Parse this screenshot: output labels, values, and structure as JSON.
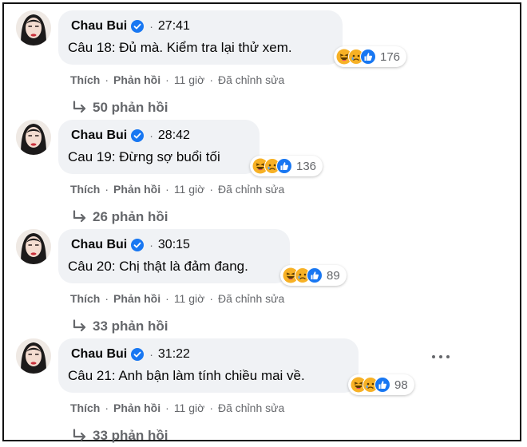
{
  "comments": [
    {
      "author": "Chau Bui",
      "stamp": "27:41",
      "text": "Câu 18: Đủ mà. Kiểm tra lại thử xem.",
      "reaction_count": "176",
      "like": "Thích",
      "reply": "Phản hồi",
      "time": "11 giờ",
      "edited": "Đã chỉnh sửa",
      "replies": "50 phản hồi"
    },
    {
      "author": "Chau Bui",
      "stamp": "28:42",
      "text": "Cau 19: Đừng sợ buổi tối",
      "reaction_count": "136",
      "like": "Thích",
      "reply": "Phản hồi",
      "time": "11 giờ",
      "edited": "Đã chỉnh sửa",
      "replies": "26 phản hồi"
    },
    {
      "author": "Chau Bui",
      "stamp": "30:15",
      "text": "Câu 20: Chị thật là đảm đang.",
      "reaction_count": "89",
      "like": "Thích",
      "reply": "Phản hồi",
      "time": "11 giờ",
      "edited": "Đã chỉnh sửa",
      "replies": "33 phản hồi"
    },
    {
      "author": "Chau Bui",
      "stamp": "31:22",
      "text": "Câu 21: Anh bận làm tính chiều mai về.",
      "reaction_count": "98",
      "like": "Thích",
      "reply": "Phản hồi",
      "time": "11 giờ",
      "edited": "Đã chỉnh sửa",
      "replies": "33 phản hồi"
    }
  ],
  "icons": {
    "verified": "verified-badge-icon",
    "haha": "haha-reaction-icon",
    "sad": "sad-reaction-icon",
    "like": "like-reaction-icon",
    "reply_arrow": "reply-arrow-icon",
    "more": "more-options-icon"
  },
  "colors": {
    "bubble": "#f0f2f5",
    "verified": "#1877f2",
    "meta_text": "#65676b",
    "reaction_yellow": "#f7b125",
    "like_blue": "#1877f2"
  }
}
